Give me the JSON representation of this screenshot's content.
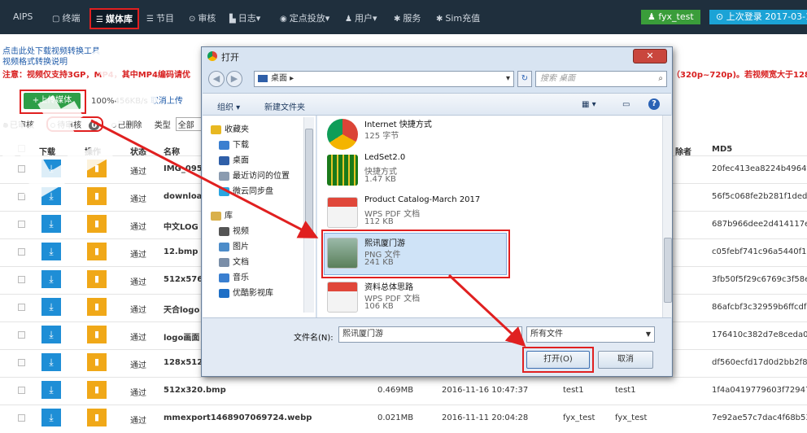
{
  "nav": {
    "brand": "AIPS",
    "items": [
      {
        "icon": "terminal-icon",
        "glyph": "▢",
        "label": "终端"
      },
      {
        "icon": "media-library-icon",
        "glyph": "☰",
        "label": "媒体库"
      },
      {
        "icon": "program-icon",
        "glyph": "☰",
        "label": "节目"
      },
      {
        "icon": "review-icon",
        "glyph": "⊙",
        "label": "审核"
      },
      {
        "icon": "log-icon",
        "glyph": "▙",
        "label": "日志▾"
      },
      {
        "icon": "location-icon",
        "glyph": "◉",
        "label": "定点投放▾"
      },
      {
        "icon": "user-icon",
        "glyph": "♟",
        "label": "用户▾"
      },
      {
        "icon": "service-icon",
        "glyph": "✱",
        "label": "服务"
      },
      {
        "icon": "sim-icon",
        "glyph": "✱",
        "label": "Sim充值"
      }
    ],
    "user": "fyx_test",
    "last_login": "上次登录 2017-03-17",
    "colors": {
      "bar": "#1f2f3d",
      "user": "#3a9d3a",
      "login": "#1ba3d6"
    }
  },
  "info": {
    "tool_link": "点击此处下载视频转换工具",
    "convert_note": "视频格式转换说明",
    "notice": "注意：视频仅支持3GP，MP4，其中MP4编码请优",
    "notice_tail": "（320p~720p)。若视频宽大于128"
  },
  "upload": {
    "button": "上传媒体",
    "status": "100%456KB/s",
    "cancel": "取消上传"
  },
  "filters": {
    "approved": "已审核",
    "pending": "待审核",
    "pending_count": "0",
    "deleted": "已删除",
    "type_label": "类型",
    "type_value": "全部"
  },
  "table": {
    "headers": {
      "download": "下载",
      "action": "操作",
      "status": "状态",
      "name": "名称",
      "deleter": "除者",
      "md5": "MD5"
    },
    "rows": [
      {
        "status": "通过",
        "name": "IMG_095",
        "size": "",
        "date": "",
        "uploader": "",
        "deleter": "",
        "md5": "20fec413ea8224b4964fc"
      },
      {
        "status": "通过",
        "name": "downloa",
        "size": "",
        "date": "",
        "uploader": "",
        "deleter": "",
        "md5": "56f5c068fe2b281f1ded8"
      },
      {
        "status": "通过",
        "name": "中文LOG",
        "size": "",
        "date": "",
        "uploader": "",
        "deleter": "",
        "md5": "687b966dee2d414117eb"
      },
      {
        "status": "通过",
        "name": "12.bmp",
        "size": "",
        "date": "",
        "uploader": "",
        "deleter": "",
        "md5": "c05febf741c96a5440f11"
      },
      {
        "status": "通过",
        "name": "512x576",
        "size": "",
        "date": "",
        "uploader": "",
        "deleter": "",
        "md5": "3fb50f5f29c6769c3f58e4"
      },
      {
        "status": "通过",
        "name": "天合logo",
        "size": "",
        "date": "",
        "uploader": "",
        "deleter": "",
        "md5": "86afcbf3c32959b6ffcdf7"
      },
      {
        "status": "通过",
        "name": "logo画面",
        "size": "",
        "date": "",
        "uploader": "",
        "deleter": "",
        "md5": "176410c382d7e8ceda0e"
      },
      {
        "status": "通过",
        "name": "128x512",
        "size": "",
        "date": "",
        "uploader": "",
        "deleter": "",
        "md5": "df560ecfd17d0d2bb2f88"
      },
      {
        "status": "通过",
        "name": "512x320.bmp",
        "size": "0.469MB",
        "date": "2016-11-16 10:47:37",
        "uploader": "test1",
        "deleter": "test1",
        "md5": "1f4a0419779603f72947"
      },
      {
        "status": "通过",
        "name": "mmexport1468907069724.webp",
        "size": "0.021MB",
        "date": "2016-11-11 20:04:28",
        "uploader": "fyx_test",
        "deleter": "fyx_test",
        "md5": "7e92ae57c7dac4f68b53"
      }
    ]
  },
  "dialog": {
    "title": "打开",
    "close": "✕",
    "path": "桌面 ▸",
    "search_placeholder": "搜索 桌面",
    "toolbar": {
      "organize": "组织 ▾",
      "new_folder": "新建文件夹"
    },
    "nav_pane": [
      {
        "icon": "favorites-icon",
        "label": "收藏夹",
        "color": "#e8b821"
      },
      {
        "icon": "download-folder-icon",
        "label": "下载",
        "color": "#3a7fd0"
      },
      {
        "icon": "desktop-icon",
        "label": "桌面",
        "color": "#2f5fa8"
      },
      {
        "icon": "recent-places-icon",
        "label": "最近访问的位置",
        "color": "#8a9bb0"
      },
      {
        "icon": "weiyun-icon",
        "label": "微云同步盘",
        "color": "#2aa5e0"
      },
      {
        "icon": "library-icon",
        "label": "库",
        "color": "#d9b04a"
      },
      {
        "icon": "video-icon",
        "label": "视频",
        "color": "#555"
      },
      {
        "icon": "pictures-icon",
        "label": "图片",
        "color": "#4c8cc9"
      },
      {
        "icon": "documents-icon",
        "label": "文档",
        "color": "#7a8ea8"
      },
      {
        "icon": "music-icon",
        "label": "音乐",
        "color": "#3a7fd0"
      },
      {
        "icon": "youku-icon",
        "label": "优酷影视库",
        "color": "#1e6fc6"
      }
    ],
    "files": [
      {
        "icon": "chrome-shortcut-icon",
        "name": "Internet 快捷方式",
        "type": "125 字节",
        "size": ""
      },
      {
        "icon": "ledset-shortcut-icon",
        "name": "LedSet2.0",
        "type": "快捷方式",
        "size": "1.47 KB"
      },
      {
        "icon": "pdf-file-icon",
        "name": "Product Catalog-March 2017",
        "type": "WPS PDF 文档",
        "size": "112 KB"
      },
      {
        "icon": "png-image-icon",
        "name": "熙讯厦门游",
        "type": "PNG 文件",
        "size": "241 KB"
      },
      {
        "icon": "pdf-file-icon",
        "name": "资料总体思路",
        "type": "WPS PDF 文档",
        "size": "106 KB"
      }
    ],
    "filename_label": "文件名(N):",
    "filename_value": "熙讯厦门游",
    "filetype": "所有文件",
    "open": "打开(O)",
    "cancel": "取消"
  }
}
